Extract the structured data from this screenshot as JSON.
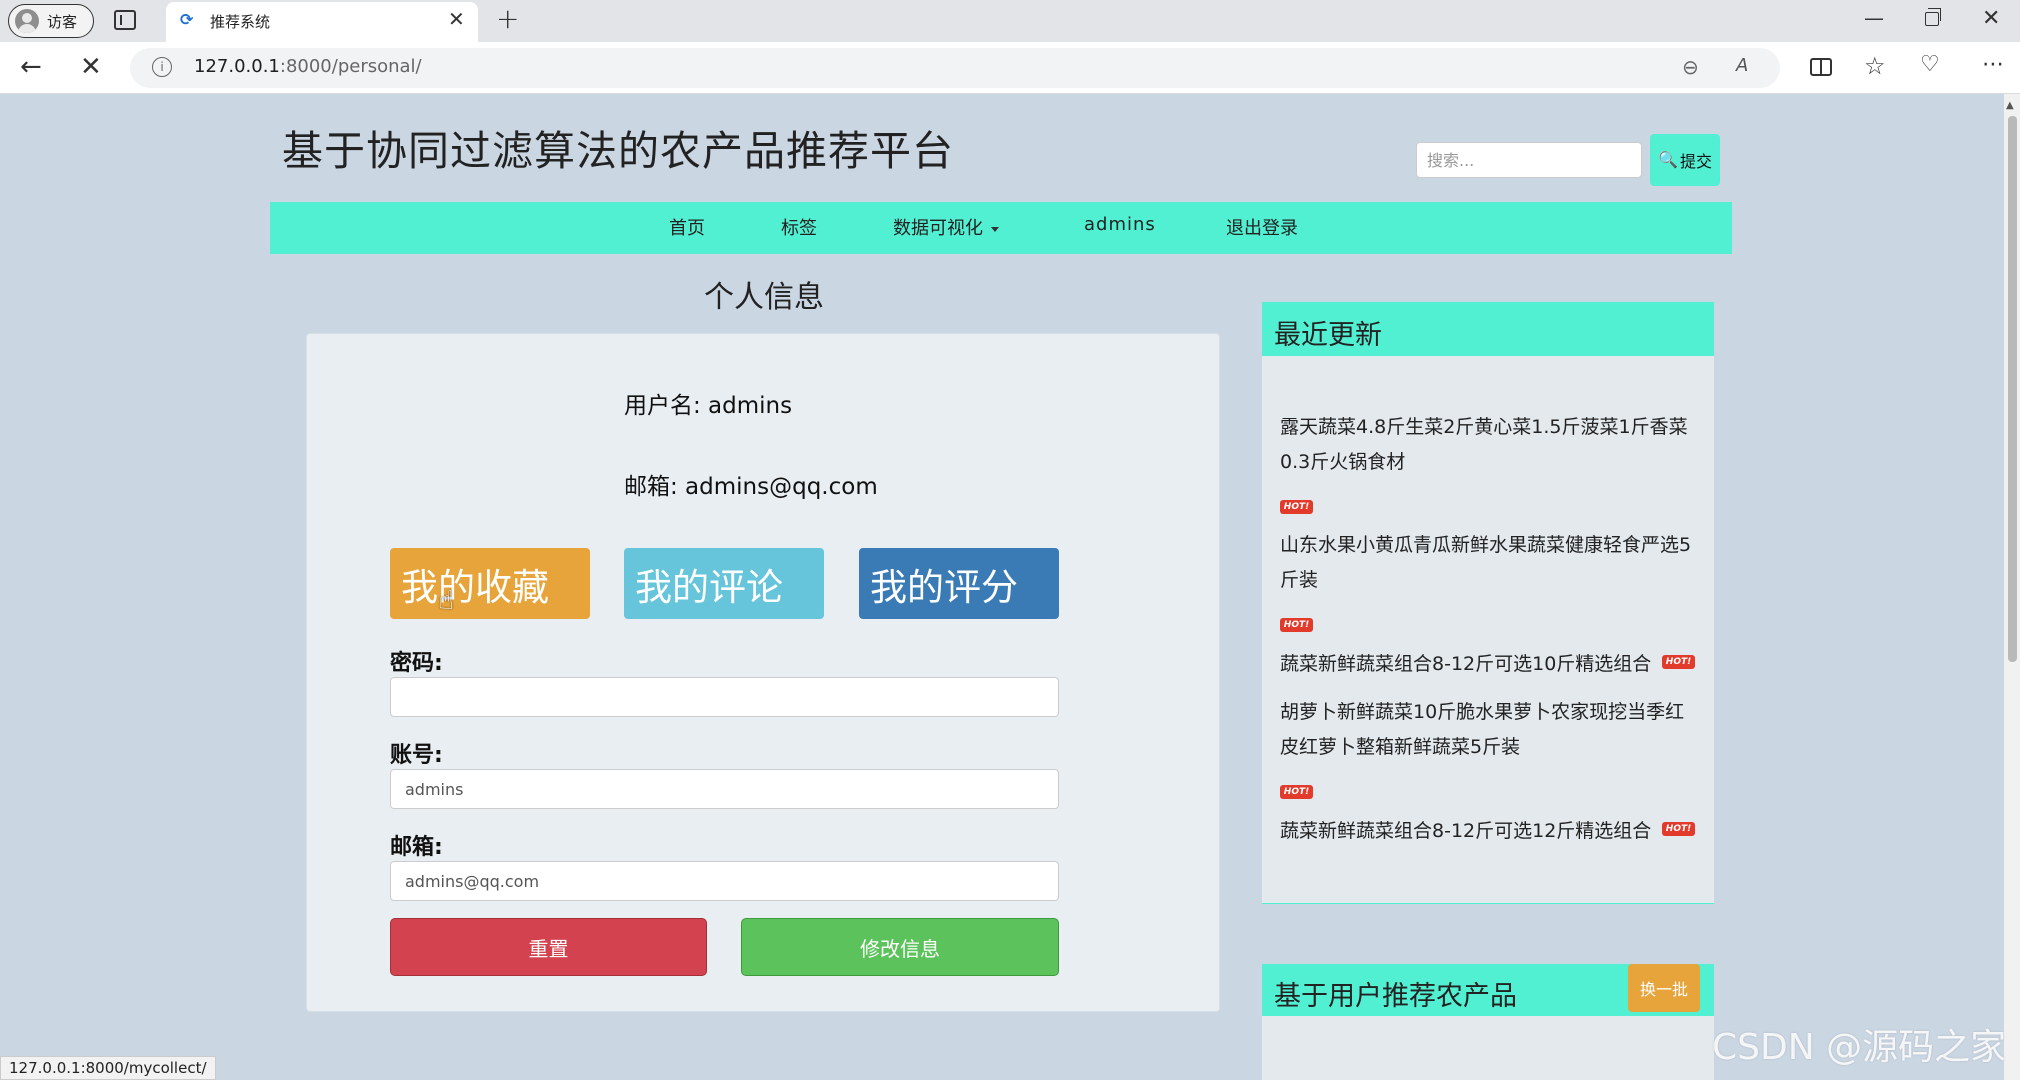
{
  "browser": {
    "profile_label": "访客",
    "tab_title": "推荐系统",
    "url_host": "127.0.0.1",
    "url_rest": ":8000/personal/",
    "status_url": "127.0.0.1:8000/mycollect/"
  },
  "site": {
    "title": "基于协同过滤算法的农产品推荐平台",
    "search_placeholder": "搜索...",
    "search_button": "提交"
  },
  "nav": {
    "items": [
      "首页",
      "标签",
      "数据可视化",
      "admins",
      "退出登录"
    ]
  },
  "personal": {
    "heading": "个人信息",
    "username_line": "用户名: admins",
    "email_line": "邮箱: admins@qq.com",
    "buttons": [
      "我的收藏",
      "我的评论",
      "我的评分"
    ],
    "form": {
      "password_label": "密码:",
      "password_value": "",
      "account_label": "账号:",
      "account_value": "admins",
      "email_label": "邮箱:",
      "email_value": "admins@qq.com",
      "reset_label": "重置",
      "submit_label": "修改信息"
    }
  },
  "recent": {
    "title": "最近更新",
    "hot_badge": "HOT!",
    "items": [
      "露天蔬菜4.8斤生菜2斤黄心菜1.5斤菠菜1斤香菜0.3斤火锅食材",
      "山东水果小黄瓜青瓜新鲜水果蔬菜健康轻食严选5斤装",
      "蔬菜新鲜蔬菜组合8-12斤可选10斤精选组合",
      "胡萝卜新鲜蔬菜10斤脆水果萝卜农家现挖当季红皮红萝卜整箱新鲜蔬菜5斤装",
      "蔬菜新鲜蔬菜组合8-12斤可选12斤精选组合"
    ]
  },
  "recommend": {
    "title": "基于用户推荐农产品",
    "refresh_label": "换一批"
  },
  "watermark": "CSDN @源码之家",
  "colors": {
    "accent_teal": "#52f0d2",
    "page_bg": "#cbd6e3",
    "collect": "#e7a43a",
    "comment": "#66c5da",
    "rating": "#3a7bb6",
    "reset": "#d2434f",
    "submit": "#5cc35c"
  }
}
